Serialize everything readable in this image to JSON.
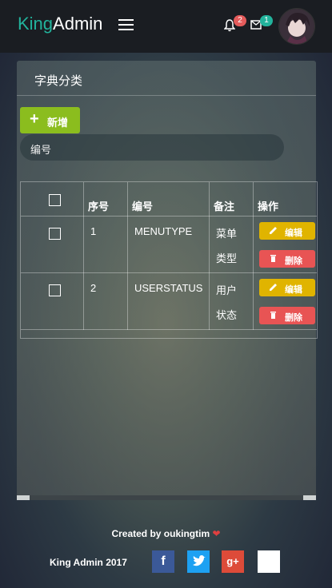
{
  "header": {
    "brand_part1": "King",
    "brand_part2": "Admin",
    "notifications_count": "2",
    "messages_count": "1"
  },
  "panel": {
    "title": "字典分类",
    "add_button_label": "新增",
    "search_placeholder": "编号"
  },
  "table": {
    "headers": {
      "index": "序号",
      "code": "编号",
      "remark": "备注",
      "action": "操作"
    },
    "rows": [
      {
        "index": "1",
        "code": "MENUTYPE",
        "remark_line1": "菜单",
        "remark_line2": "类型",
        "edit": "编辑",
        "delete": "删除"
      },
      {
        "index": "2",
        "code": "USERSTATUS",
        "remark_line1": "用户",
        "remark_line2": "状态",
        "edit": "编辑",
        "delete": "删除"
      }
    ]
  },
  "footer": {
    "credit": "Created by oukingtim",
    "copyright": "King Admin 2017",
    "social": [
      "facebook-icon",
      "twitter-icon",
      "google-plus-icon"
    ]
  },
  "colors": {
    "brand_accent": "#22b39c",
    "add_button": "#8bbd1e",
    "edit_button": "#e0b400",
    "delete_button": "#e85454",
    "badge_red": "#e45b5b",
    "badge_teal": "#22b39c"
  }
}
